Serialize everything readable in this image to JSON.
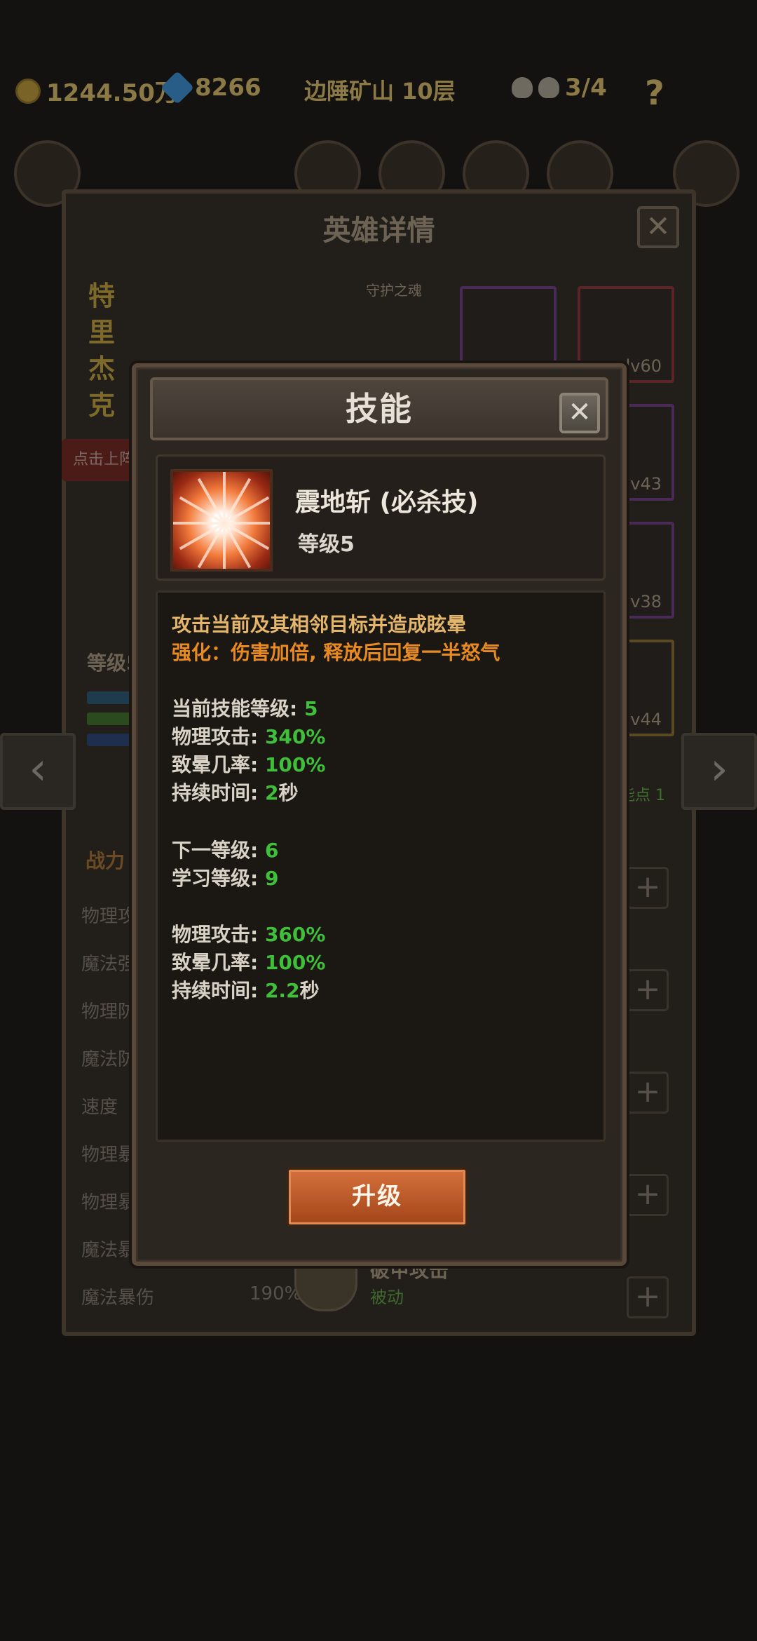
{
  "topbar": {
    "gold": "1244.50万",
    "gems": "8266",
    "stage": "边陲矿山 10层",
    "skull_count": "3/4",
    "help_label": "?"
  },
  "hero_detail": {
    "title": "英雄详情",
    "close_label": "✕",
    "hero_name": "特里杰克",
    "guard_label": "守护之魂",
    "deploy_label": "点击上阵",
    "level_label": "等级5",
    "skill_points": "能点 1",
    "power_label": "战力",
    "stats": [
      {
        "label": "物理攻",
        "value": ""
      },
      {
        "label": "魔法强",
        "value": ""
      },
      {
        "label": "物理防",
        "value": ""
      },
      {
        "label": "魔法防",
        "value": ""
      },
      {
        "label": "速度",
        "value": ""
      },
      {
        "label": "物理暴",
        "value": ""
      },
      {
        "label": "物理暴",
        "value": ""
      },
      {
        "label": "魔法暴",
        "value": ""
      },
      {
        "label": "魔法暴伤",
        "value": "190%"
      }
    ],
    "equipment": [
      {
        "level": ""
      },
      {
        "level": "lv60"
      },
      {
        "level": "lv43"
      },
      {
        "level": "lv38"
      },
      {
        "level": "lv44"
      }
    ],
    "bg_skill": {
      "name": "破甲攻击",
      "type": "被动"
    },
    "plus_label": "+"
  },
  "nav": {
    "prev_label": "‹",
    "next_label": "›"
  },
  "skill_modal": {
    "title": "技能",
    "close_label": "✕",
    "skill_name": "震地斩 (必杀技)",
    "skill_level": "等级5",
    "description": "攻击当前及其相邻目标并造成眩晕",
    "enhance": "强化：伤害加倍, 释放后回复一半怒气",
    "current": [
      {
        "label": "当前技能等级: ",
        "value": "5"
      },
      {
        "label": "物理攻击: ",
        "value": "340%"
      },
      {
        "label": "致晕几率: ",
        "value": "100%"
      },
      {
        "label": "持续时间: ",
        "value": "2",
        "suffix": "秒"
      }
    ],
    "next": [
      {
        "label": "下一等级: ",
        "value": "6"
      },
      {
        "label": "学习等级: ",
        "value": "9"
      }
    ],
    "next_stats": [
      {
        "label": "物理攻击: ",
        "value": "360%"
      },
      {
        "label": "致晕几率: ",
        "value": "100%"
      },
      {
        "label": "持续时间: ",
        "value": "2.2",
        "suffix": "秒"
      }
    ],
    "upgrade_label": "升级"
  },
  "colors": {
    "highlight_orange": "#e88a20",
    "value_green": "#3fbf3a",
    "title_gold": "#e3b66b",
    "button_orange": "#c4592a"
  }
}
